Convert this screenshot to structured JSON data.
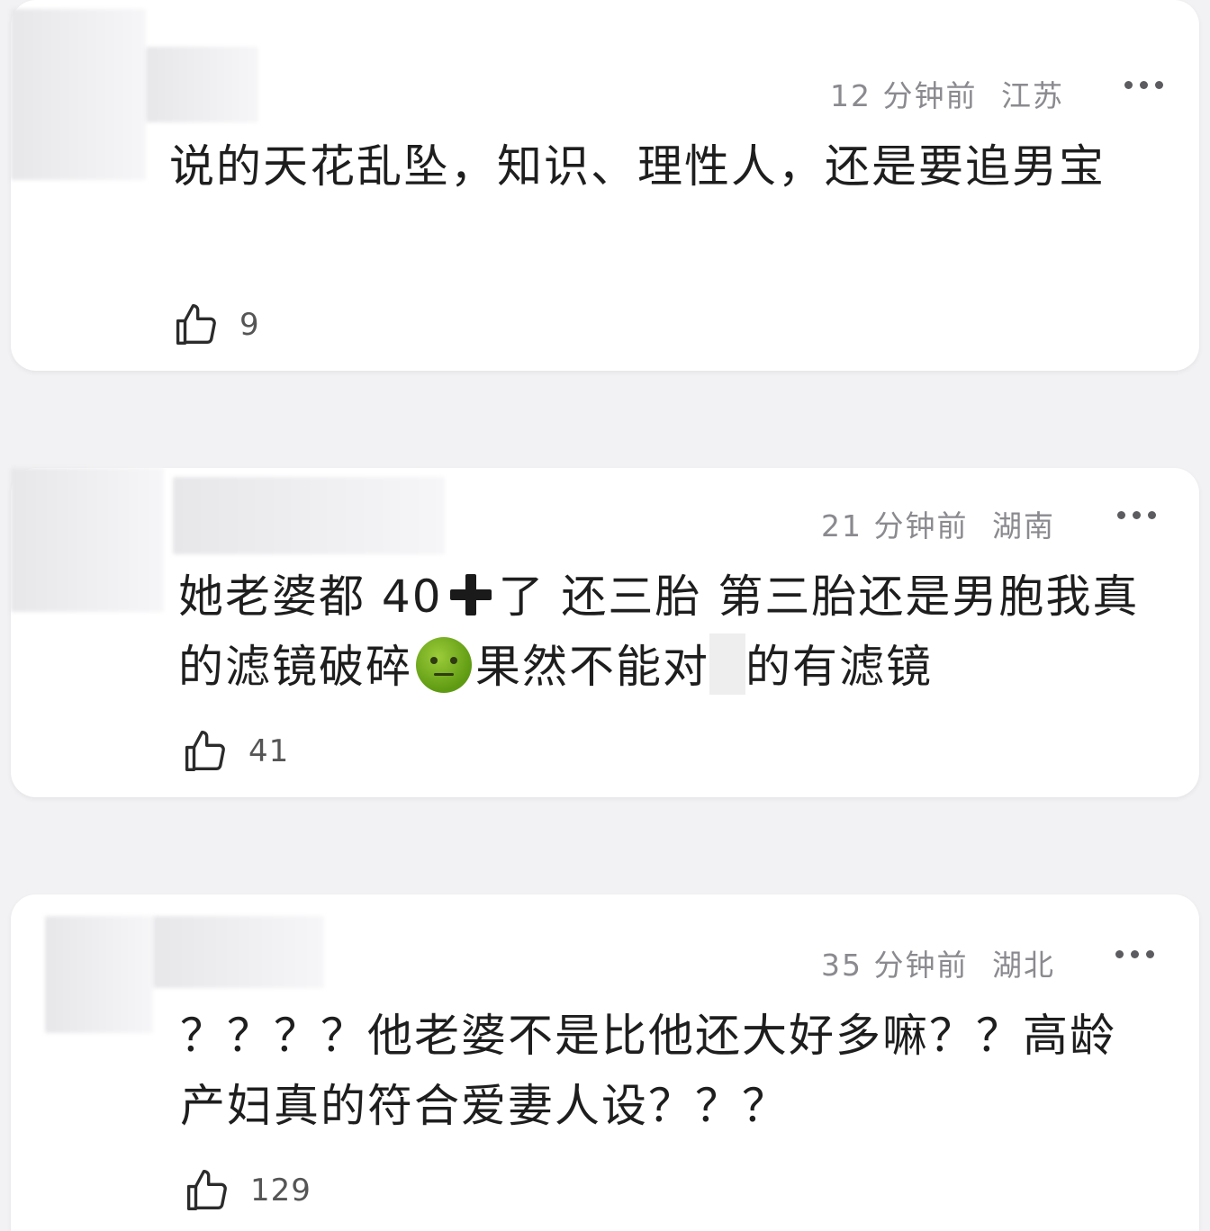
{
  "comments": [
    {
      "time": "12 分钟前",
      "location": "江苏",
      "text": "说的天花乱坠，知识、理性人，还是要追男宝",
      "likes": "9"
    },
    {
      "time": "21 分钟前",
      "location": "湖南",
      "text_part1": "她老婆都 40",
      "text_part2": "了  还三胎  第三胎还是男胞我真的滤镜破碎",
      "text_part3": "果然不能对",
      "text_part4": "的有滤镜",
      "likes": "41",
      "emoji": "nauseated-face-emoji"
    },
    {
      "time": "35 分钟前",
      "location": "湖北",
      "text": "？？？？他老婆不是比他还大好多嘛？？高龄产妇真的符合爱妻人设？？？",
      "likes": "129"
    }
  ],
  "icons": {
    "like": "thumbs-up-outline-icon",
    "more": "ellipsis-icon"
  }
}
